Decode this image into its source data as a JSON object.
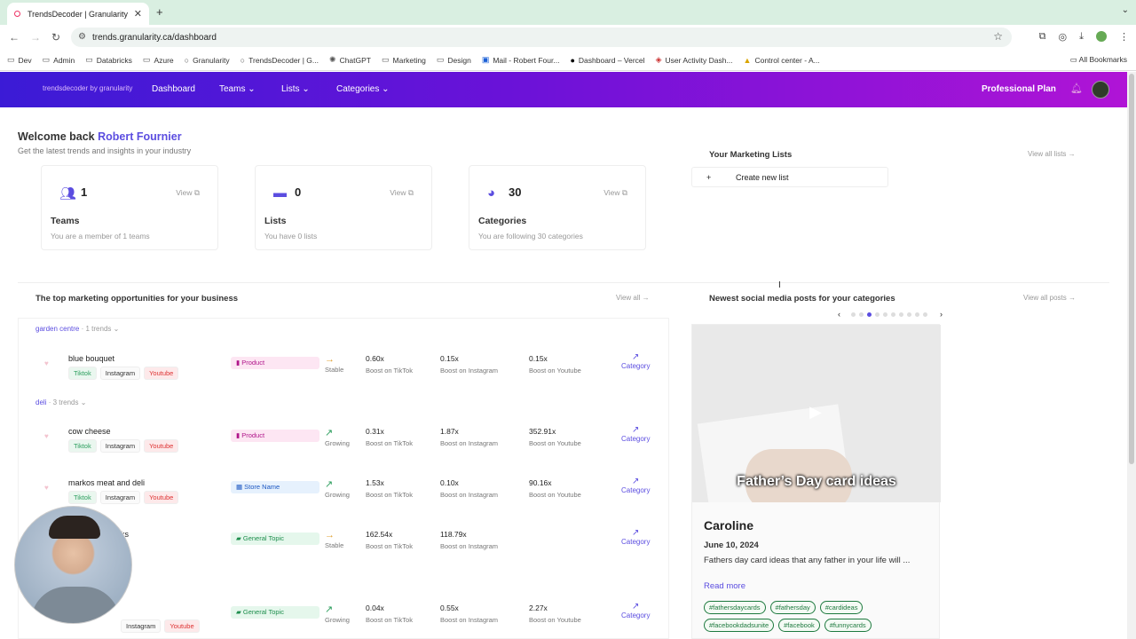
{
  "browser": {
    "tab_title": "TrendsDecoder | Granularity",
    "url": "trends.granularity.ca/dashboard",
    "bookmarks": [
      "Dev",
      "Admin",
      "Databricks",
      "Azure",
      "Granularity",
      "TrendsDecoder | G...",
      "ChatGPT",
      "Marketing",
      "Design",
      "Mail - Robert Four...",
      "Dashboard – Vercel",
      "User Activity Dash...",
      "Control center - A..."
    ],
    "all_bookmarks": "All Bookmarks"
  },
  "nav": {
    "logo": "trendsdecoder by granularity",
    "links": [
      "Dashboard",
      "Teams",
      "Lists",
      "Categories"
    ],
    "plan": "Professional Plan"
  },
  "welcome": {
    "prefix": "Welcome back",
    "name": "Robert Fournier",
    "subtitle": "Get the latest trends and insights in your industry"
  },
  "cards": [
    {
      "num": "1",
      "view": "View",
      "title": "Teams",
      "desc": "You are a member of 1 teams"
    },
    {
      "num": "0",
      "view": "View",
      "title": "Lists",
      "desc": "You have 0 lists"
    },
    {
      "num": "30",
      "view": "View",
      "title": "Categories",
      "desc": "You are following 30 categories"
    }
  ],
  "marketing_lists": {
    "title": "Your Marketing Lists",
    "view_all": "View all lists",
    "create": "Create new list",
    "plus": "+"
  },
  "opportunities": {
    "title": "The top marketing opportunities for your business",
    "view_all": "View all",
    "groups": [
      {
        "name": "garden centre",
        "count": "· 1 trends"
      },
      {
        "name": "deli",
        "count": "· 3 trends"
      }
    ],
    "rows": [
      {
        "name": "blue bouquet",
        "type": "Product",
        "trend": "Stable",
        "tiktok": "0.60x",
        "instagram": "0.15x",
        "youtube": "0.15x"
      },
      {
        "name": "cow cheese",
        "type": "Product",
        "trend": "Growing",
        "tiktok": "0.31x",
        "instagram": "1.87x",
        "youtube": "352.91x"
      },
      {
        "name": "markos meat and deli",
        "type": "Store Name",
        "trend": "Growing",
        "tiktok": "1.53x",
        "instagram": "0.10x",
        "youtube": "90.16x"
      },
      {
        "name": "ks",
        "type": "General Topic",
        "trend": "Stable",
        "tiktok": "162.54x",
        "instagram": "118.79x",
        "youtube": ""
      },
      {
        "name": "",
        "type": "General Topic",
        "trend": "Growing",
        "tiktok": "0.04x",
        "instagram": "0.55x",
        "youtube": "2.27x"
      }
    ],
    "labels": {
      "tiktok": "Boost on TikTok",
      "instagram": "Boost on Instagram",
      "youtube": "Boost on Youtube",
      "category": "Category",
      "chip_tiktok": "Tiktok",
      "chip_instagram": "Instagram",
      "chip_youtube": "Youtube"
    }
  },
  "social": {
    "title": "Newest social media posts for your categories",
    "view_all": "View all posts",
    "active_dot": 3,
    "dot_count": 10,
    "caption": "Father’s Day card ideas",
    "author": "Caroline",
    "date": "June 10, 2024",
    "text": "Fathers day card ideas that any father in your life will ...",
    "read_more": "Read more",
    "hashtags": [
      "#fathersdaycards",
      "#fathersday",
      "#cardideas",
      "#facebookdadsunite",
      "#facebook",
      "#funnycards"
    ]
  }
}
